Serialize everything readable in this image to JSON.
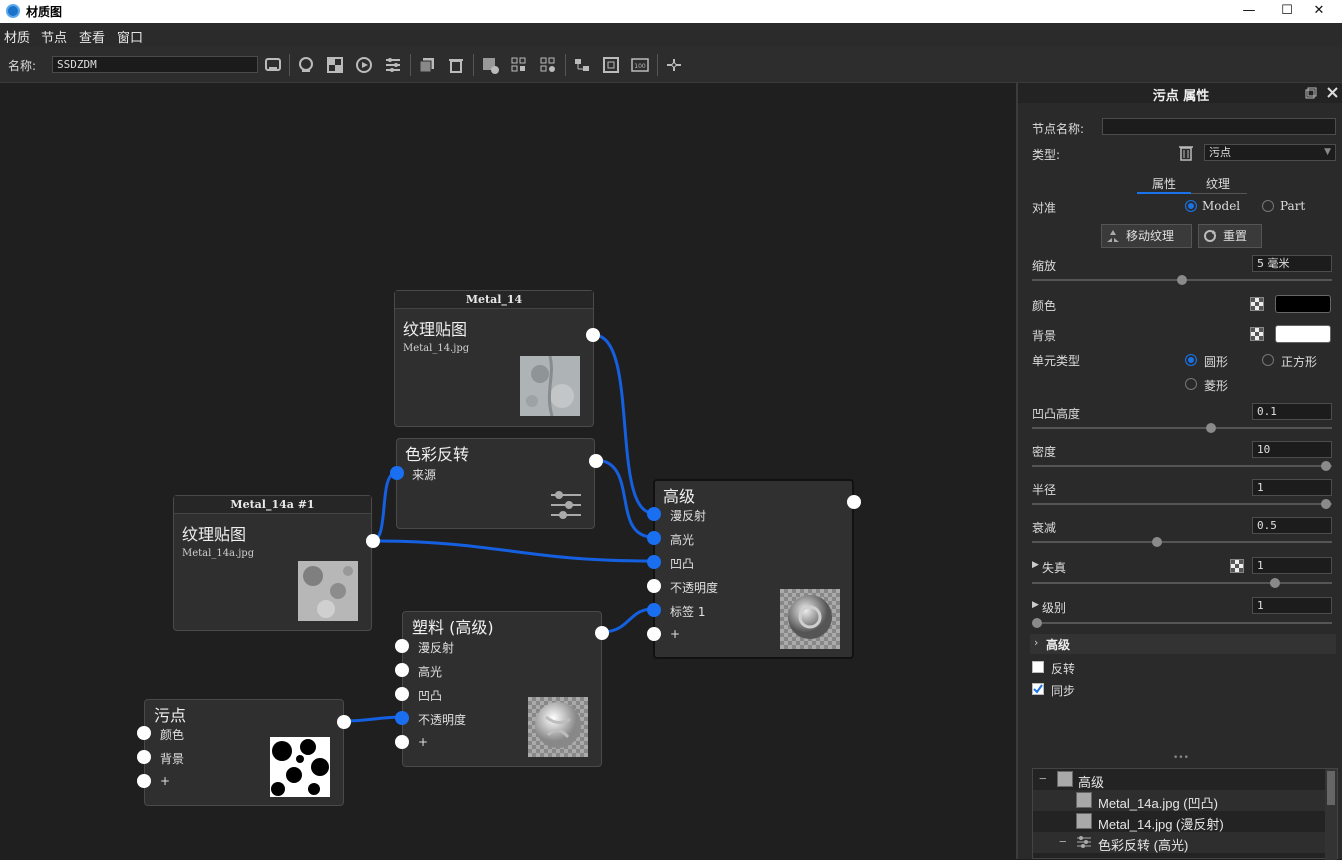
{
  "window": {
    "title": "材质图"
  },
  "menu": [
    "材质",
    "节点",
    "查看",
    "窗口"
  ],
  "toolbar": {
    "name_label": "名称:",
    "name_value": "SSDZDM"
  },
  "nodes": {
    "metal14": {
      "header": "Metal_14",
      "title": "纹理贴图",
      "file": "Metal_14.jpg"
    },
    "invert": {
      "title": "色彩反转",
      "ports": [
        "来源"
      ]
    },
    "metal14a": {
      "header": "Metal_14a #1",
      "title": "纹理贴图",
      "file": "Metal_14a.jpg"
    },
    "advanced": {
      "title": "高级",
      "ports": [
        "漫反射",
        "高光",
        "凹凸",
        "不透明度",
        "标签 1",
        "+"
      ]
    },
    "plastic": {
      "title": "塑料 (高级)",
      "ports": [
        "漫反射",
        "高光",
        "凹凸",
        "不透明度",
        "+"
      ]
    },
    "stain": {
      "title": "污点",
      "ports": [
        "颜色",
        "背景",
        "+"
      ]
    }
  },
  "panel": {
    "title": "污点 属性",
    "node_name_label": "节点名称:",
    "node_name_value": "",
    "type_label": "类型:",
    "type_value": "污点",
    "tabs": [
      "属性",
      "纹理"
    ],
    "align_label": "对准",
    "align_options": [
      "Model",
      "Part"
    ],
    "move_texture_btn": "移动纹理",
    "reset_btn": "重置",
    "scale_label": "缩放",
    "scale_value": "5 毫米",
    "color_label": "颜色",
    "color_value": "#000000",
    "bg_label": "背景",
    "bg_value": "#ffffff",
    "cell_type_label": "单元类型",
    "cell_options": [
      "圆形",
      "正方形",
      "菱形"
    ],
    "bump_label": "凹凸高度",
    "bump_value": "0.1",
    "density_label": "密度",
    "density_value": "10",
    "radius_label": "半径",
    "radius_value": "1",
    "falloff_label": "衰减",
    "falloff_value": "0.5",
    "distortion_label": "失真",
    "distortion_value": "1",
    "level_label": "级别",
    "level_value": "1",
    "advanced_section": "高级",
    "invert_label": "反转",
    "sync_label": "同步",
    "dots": "•••"
  },
  "tree": [
    {
      "label": "高级",
      "toggle": "−"
    },
    {
      "label": "Metal_14a.jpg (凹凸)"
    },
    {
      "label": "Metal_14.jpg (漫反射)"
    },
    {
      "label": "色彩反转 (高光)",
      "toggle": "−"
    }
  ],
  "colors": {
    "accent": "#1a73e8",
    "wire": "#1560e0"
  }
}
